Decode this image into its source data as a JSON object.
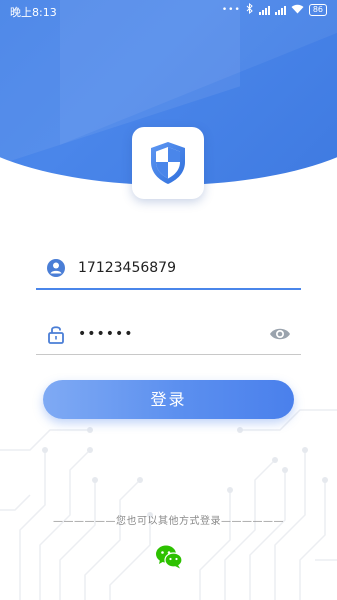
{
  "status_bar": {
    "time": "晚上8:13",
    "indicator_dots": "•••",
    "battery": "86"
  },
  "login_form": {
    "phone_value": "17123456879",
    "password_mask": "••••••",
    "submit_label": "登录"
  },
  "alt_login": {
    "label": "——————您也可以其他方式登录——————"
  },
  "colors": {
    "primary": "#4a86ea",
    "button_start": "#7faaf4",
    "button_end": "#4a80ec",
    "wechat_green": "#2dc100"
  },
  "icons": {
    "logo": "shield-icon",
    "phone_field": "user-icon",
    "password_field": "lock-icon",
    "password_visibility": "eye-icon",
    "alt_login": "wechat-icon"
  }
}
